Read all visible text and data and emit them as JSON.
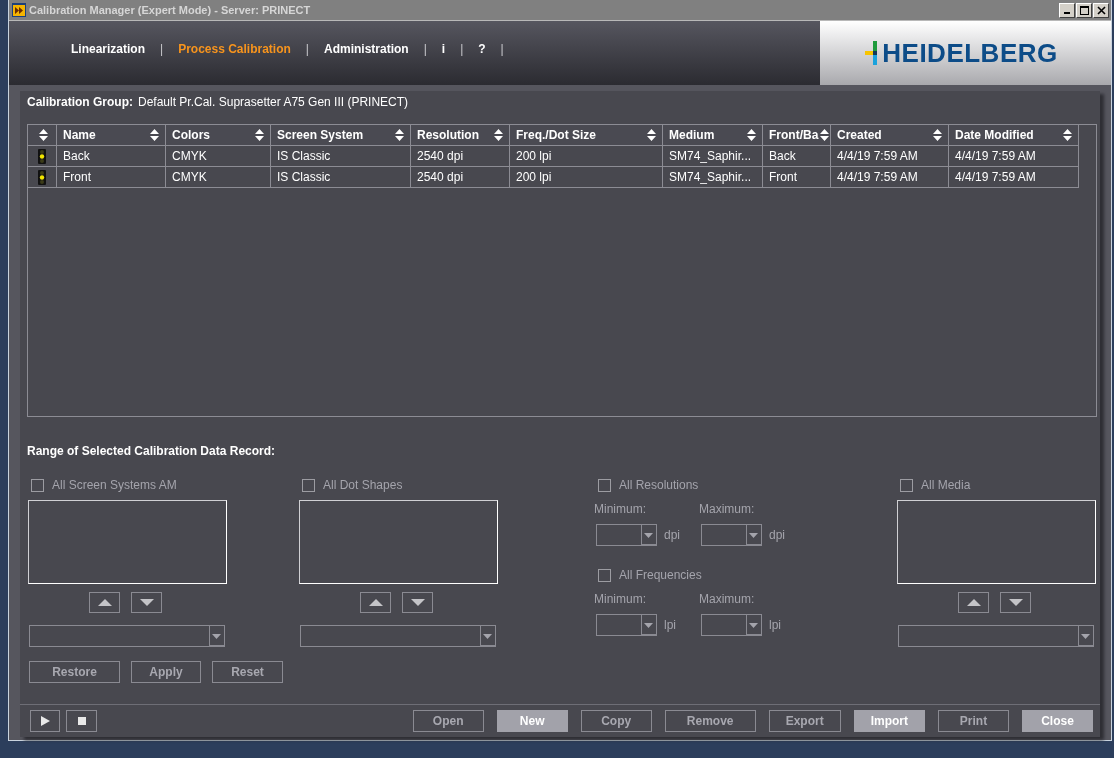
{
  "window": {
    "title": "Calibration Manager (Expert Mode) - Server: PRINECT"
  },
  "nav": [
    {
      "label": "Linearization",
      "separator": "|",
      "selected": false
    },
    {
      "label": "Process Calibration",
      "separator": "|",
      "selected": true
    },
    {
      "label": "Administration",
      "separator": "|",
      "selected": false
    },
    {
      "label": "i",
      "separator": "|",
      "selected": false
    },
    {
      "label": "?",
      "separator": "|",
      "selected": false
    }
  ],
  "logo": {
    "text": "HEIDELBERG"
  },
  "calibration_group": {
    "label": "Calibration Group:",
    "value": "Default Pr.Cal. Suprasetter A75 Gen III (PRINECT)"
  },
  "table": {
    "columns": [
      "Name",
      "Colors",
      "Screen System",
      "Resolution",
      "Freq./Dot Size",
      "Medium",
      "Front/Ba",
      "Created",
      "Date Modified"
    ],
    "rows": [
      {
        "cells": [
          "Back",
          "CMYK",
          "IS Classic",
          "2540 dpi",
          "200 lpi",
          "SM74_Saphir...",
          "Back",
          "4/4/19 7:59 AM",
          "4/4/19 7:59 AM"
        ]
      },
      {
        "cells": [
          "Front",
          "CMYK",
          "IS Classic",
          "2540 dpi",
          "200 lpi",
          "SM74_Saphir...",
          "Front",
          "4/4/19 7:59 AM",
          "4/4/19 7:59 AM"
        ]
      }
    ]
  },
  "range": {
    "title": "Range of Selected Calibration Data Record:",
    "groups": [
      {
        "kind": "list",
        "label": "All Screen Systems AM",
        "checked": false,
        "disabled": true
      },
      {
        "kind": "list",
        "label": "All Dot Shapes",
        "checked": false,
        "disabled": true
      },
      {
        "kind": "limits",
        "filters": [
          {
            "label": "All Resolutions",
            "checked": false,
            "disabled": true,
            "limits": [
              {
                "label": "Minimum:",
                "unit": "dpi"
              },
              {
                "label": "Maximum:",
                "unit": "dpi"
              }
            ]
          },
          {
            "label": "All Frequencies",
            "checked": false,
            "disabled": true,
            "limits": [
              {
                "label": "Minimum:",
                "unit": "lpi"
              },
              {
                "label": "Maximum:",
                "unit": "lpi"
              }
            ]
          }
        ]
      },
      {
        "kind": "list",
        "label": "All Media",
        "checked": false,
        "disabled": true
      }
    ],
    "buttons": [
      {
        "label": "Restore",
        "disabled": true
      },
      {
        "label": "Apply",
        "disabled": true
      },
      {
        "label": "Reset",
        "disabled": true
      }
    ]
  },
  "actions": [
    {
      "label": "Open",
      "disabled": true
    },
    {
      "label": "New",
      "disabled": false
    },
    {
      "label": "Copy",
      "disabled": true
    },
    {
      "label": "Remove",
      "disabled": true
    },
    {
      "label": "Export",
      "disabled": true
    },
    {
      "label": "Import",
      "disabled": false
    },
    {
      "label": "Print",
      "disabled": true
    },
    {
      "label": "Close",
      "disabled": false
    }
  ]
}
